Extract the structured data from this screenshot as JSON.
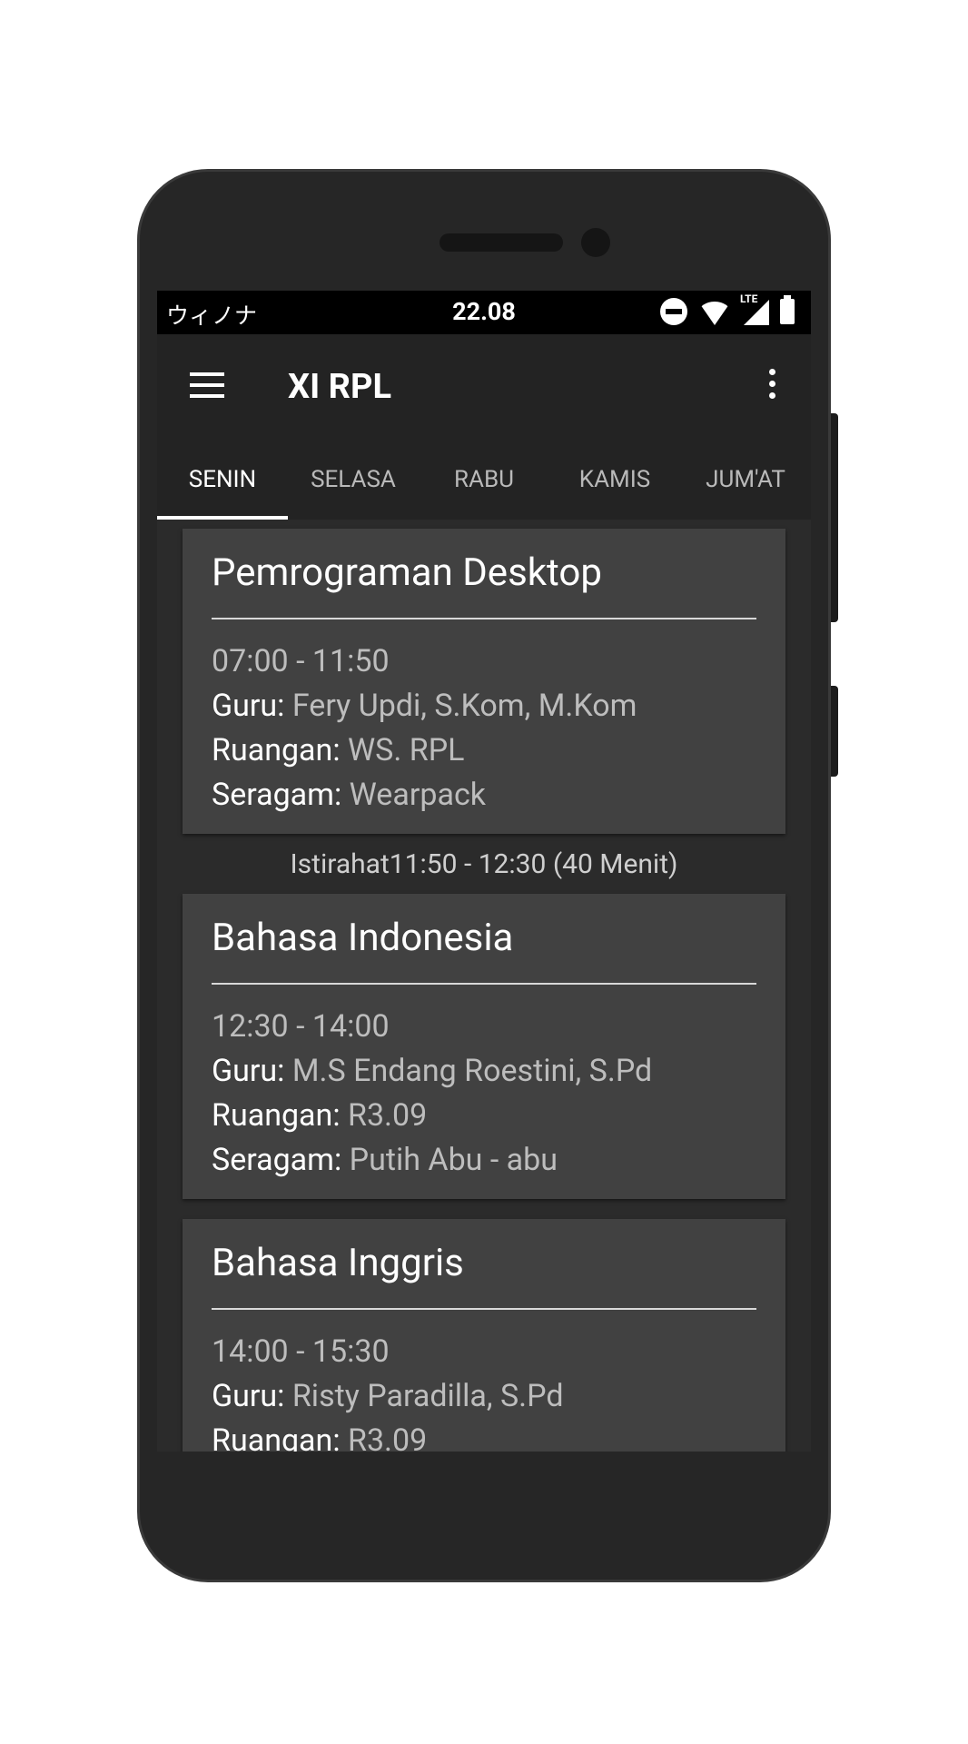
{
  "status_bar": {
    "carrier": "ウィノナ",
    "time": "22.08",
    "icons": [
      "do-not-disturb-icon",
      "wifi-icon",
      "lte-signal-icon",
      "battery-icon"
    ],
    "network_label": "LTE"
  },
  "app_bar": {
    "title": "XI RPL",
    "menu_icon": "hamburger-menu-icon",
    "overflow_icon": "more-vert-icon"
  },
  "tabs": [
    {
      "label": "SENIN",
      "active": true
    },
    {
      "label": "SELASA",
      "active": false
    },
    {
      "label": "RABU",
      "active": false
    },
    {
      "label": "KAMIS",
      "active": false
    },
    {
      "label": "JUM'AT",
      "active": false
    }
  ],
  "labels": {
    "guru": "Guru:",
    "ruangan": "Ruangan:",
    "seragam": "Seragam:"
  },
  "schedule": [
    {
      "subject": "Pemrograman Desktop",
      "time": "07:00 - 11:50",
      "guru": "Fery Updi, S.Kom, M.Kom",
      "ruangan": "WS. RPL",
      "seragam": "Wearpack"
    },
    {
      "subject": "Bahasa Indonesia",
      "time": "12:30 - 14:00",
      "guru": "M.S Endang Roestini, S.Pd",
      "ruangan": "R3.09",
      "seragam": "Putih Abu - abu"
    },
    {
      "subject": "Bahasa Inggris",
      "time": "14:00 - 15:30",
      "guru": "Risty Paradilla, S.Pd",
      "ruangan": "R3.09"
    }
  ],
  "break_text": "Istirahat11:50 - 12:30 (40 Menit)",
  "colors": {
    "app_bar": "#232323",
    "card": "#414141",
    "background": "#2b2b2b",
    "accent": "#ffffff"
  }
}
